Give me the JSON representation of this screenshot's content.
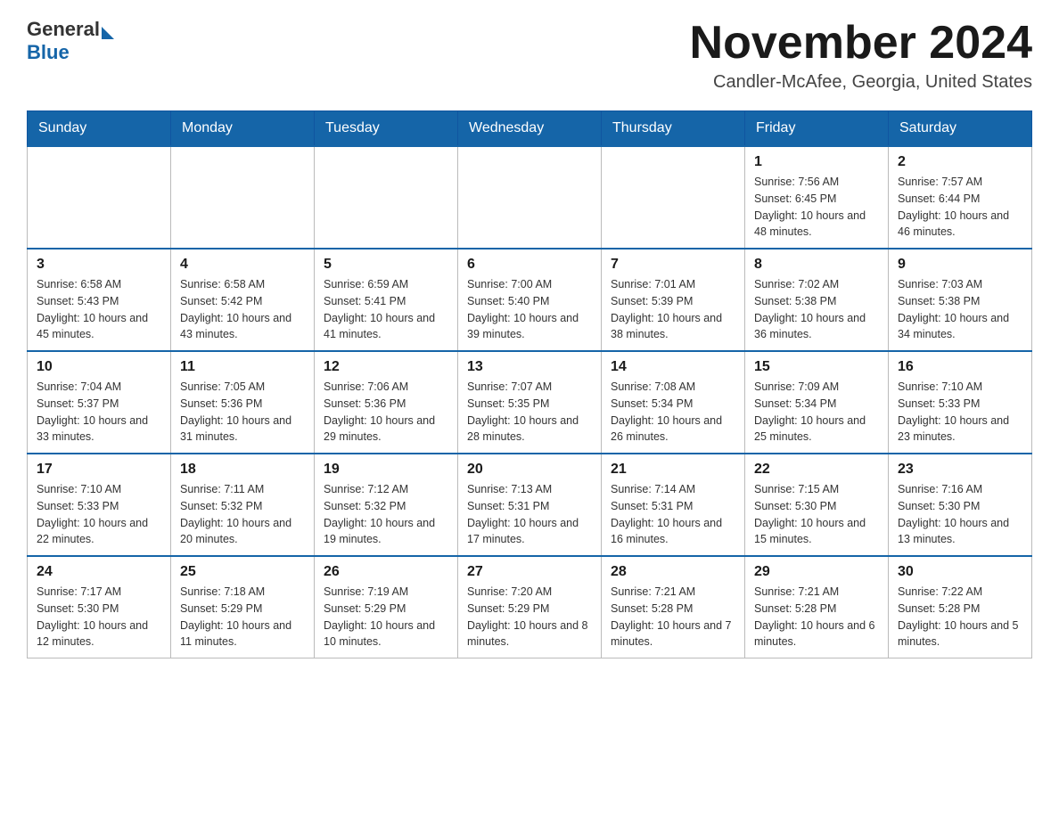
{
  "logo": {
    "text_general": "General",
    "text_blue": "Blue"
  },
  "header": {
    "month_title": "November 2024",
    "subtitle": "Candler-McAfee, Georgia, United States"
  },
  "days_of_week": [
    "Sunday",
    "Monday",
    "Tuesday",
    "Wednesday",
    "Thursday",
    "Friday",
    "Saturday"
  ],
  "weeks": [
    [
      {
        "day": "",
        "sunrise": "",
        "sunset": "",
        "daylight": ""
      },
      {
        "day": "",
        "sunrise": "",
        "sunset": "",
        "daylight": ""
      },
      {
        "day": "",
        "sunrise": "",
        "sunset": "",
        "daylight": ""
      },
      {
        "day": "",
        "sunrise": "",
        "sunset": "",
        "daylight": ""
      },
      {
        "day": "",
        "sunrise": "",
        "sunset": "",
        "daylight": ""
      },
      {
        "day": "1",
        "sunrise": "Sunrise: 7:56 AM",
        "sunset": "Sunset: 6:45 PM",
        "daylight": "Daylight: 10 hours and 48 minutes."
      },
      {
        "day": "2",
        "sunrise": "Sunrise: 7:57 AM",
        "sunset": "Sunset: 6:44 PM",
        "daylight": "Daylight: 10 hours and 46 minutes."
      }
    ],
    [
      {
        "day": "3",
        "sunrise": "Sunrise: 6:58 AM",
        "sunset": "Sunset: 5:43 PM",
        "daylight": "Daylight: 10 hours and 45 minutes."
      },
      {
        "day": "4",
        "sunrise": "Sunrise: 6:58 AM",
        "sunset": "Sunset: 5:42 PM",
        "daylight": "Daylight: 10 hours and 43 minutes."
      },
      {
        "day": "5",
        "sunrise": "Sunrise: 6:59 AM",
        "sunset": "Sunset: 5:41 PM",
        "daylight": "Daylight: 10 hours and 41 minutes."
      },
      {
        "day": "6",
        "sunrise": "Sunrise: 7:00 AM",
        "sunset": "Sunset: 5:40 PM",
        "daylight": "Daylight: 10 hours and 39 minutes."
      },
      {
        "day": "7",
        "sunrise": "Sunrise: 7:01 AM",
        "sunset": "Sunset: 5:39 PM",
        "daylight": "Daylight: 10 hours and 38 minutes."
      },
      {
        "day": "8",
        "sunrise": "Sunrise: 7:02 AM",
        "sunset": "Sunset: 5:38 PM",
        "daylight": "Daylight: 10 hours and 36 minutes."
      },
      {
        "day": "9",
        "sunrise": "Sunrise: 7:03 AM",
        "sunset": "Sunset: 5:38 PM",
        "daylight": "Daylight: 10 hours and 34 minutes."
      }
    ],
    [
      {
        "day": "10",
        "sunrise": "Sunrise: 7:04 AM",
        "sunset": "Sunset: 5:37 PM",
        "daylight": "Daylight: 10 hours and 33 minutes."
      },
      {
        "day": "11",
        "sunrise": "Sunrise: 7:05 AM",
        "sunset": "Sunset: 5:36 PM",
        "daylight": "Daylight: 10 hours and 31 minutes."
      },
      {
        "day": "12",
        "sunrise": "Sunrise: 7:06 AM",
        "sunset": "Sunset: 5:36 PM",
        "daylight": "Daylight: 10 hours and 29 minutes."
      },
      {
        "day": "13",
        "sunrise": "Sunrise: 7:07 AM",
        "sunset": "Sunset: 5:35 PM",
        "daylight": "Daylight: 10 hours and 28 minutes."
      },
      {
        "day": "14",
        "sunrise": "Sunrise: 7:08 AM",
        "sunset": "Sunset: 5:34 PM",
        "daylight": "Daylight: 10 hours and 26 minutes."
      },
      {
        "day": "15",
        "sunrise": "Sunrise: 7:09 AM",
        "sunset": "Sunset: 5:34 PM",
        "daylight": "Daylight: 10 hours and 25 minutes."
      },
      {
        "day": "16",
        "sunrise": "Sunrise: 7:10 AM",
        "sunset": "Sunset: 5:33 PM",
        "daylight": "Daylight: 10 hours and 23 minutes."
      }
    ],
    [
      {
        "day": "17",
        "sunrise": "Sunrise: 7:10 AM",
        "sunset": "Sunset: 5:33 PM",
        "daylight": "Daylight: 10 hours and 22 minutes."
      },
      {
        "day": "18",
        "sunrise": "Sunrise: 7:11 AM",
        "sunset": "Sunset: 5:32 PM",
        "daylight": "Daylight: 10 hours and 20 minutes."
      },
      {
        "day": "19",
        "sunrise": "Sunrise: 7:12 AM",
        "sunset": "Sunset: 5:32 PM",
        "daylight": "Daylight: 10 hours and 19 minutes."
      },
      {
        "day": "20",
        "sunrise": "Sunrise: 7:13 AM",
        "sunset": "Sunset: 5:31 PM",
        "daylight": "Daylight: 10 hours and 17 minutes."
      },
      {
        "day": "21",
        "sunrise": "Sunrise: 7:14 AM",
        "sunset": "Sunset: 5:31 PM",
        "daylight": "Daylight: 10 hours and 16 minutes."
      },
      {
        "day": "22",
        "sunrise": "Sunrise: 7:15 AM",
        "sunset": "Sunset: 5:30 PM",
        "daylight": "Daylight: 10 hours and 15 minutes."
      },
      {
        "day": "23",
        "sunrise": "Sunrise: 7:16 AM",
        "sunset": "Sunset: 5:30 PM",
        "daylight": "Daylight: 10 hours and 13 minutes."
      }
    ],
    [
      {
        "day": "24",
        "sunrise": "Sunrise: 7:17 AM",
        "sunset": "Sunset: 5:30 PM",
        "daylight": "Daylight: 10 hours and 12 minutes."
      },
      {
        "day": "25",
        "sunrise": "Sunrise: 7:18 AM",
        "sunset": "Sunset: 5:29 PM",
        "daylight": "Daylight: 10 hours and 11 minutes."
      },
      {
        "day": "26",
        "sunrise": "Sunrise: 7:19 AM",
        "sunset": "Sunset: 5:29 PM",
        "daylight": "Daylight: 10 hours and 10 minutes."
      },
      {
        "day": "27",
        "sunrise": "Sunrise: 7:20 AM",
        "sunset": "Sunset: 5:29 PM",
        "daylight": "Daylight: 10 hours and 8 minutes."
      },
      {
        "day": "28",
        "sunrise": "Sunrise: 7:21 AM",
        "sunset": "Sunset: 5:28 PM",
        "daylight": "Daylight: 10 hours and 7 minutes."
      },
      {
        "day": "29",
        "sunrise": "Sunrise: 7:21 AM",
        "sunset": "Sunset: 5:28 PM",
        "daylight": "Daylight: 10 hours and 6 minutes."
      },
      {
        "day": "30",
        "sunrise": "Sunrise: 7:22 AM",
        "sunset": "Sunset: 5:28 PM",
        "daylight": "Daylight: 10 hours and 5 minutes."
      }
    ]
  ]
}
